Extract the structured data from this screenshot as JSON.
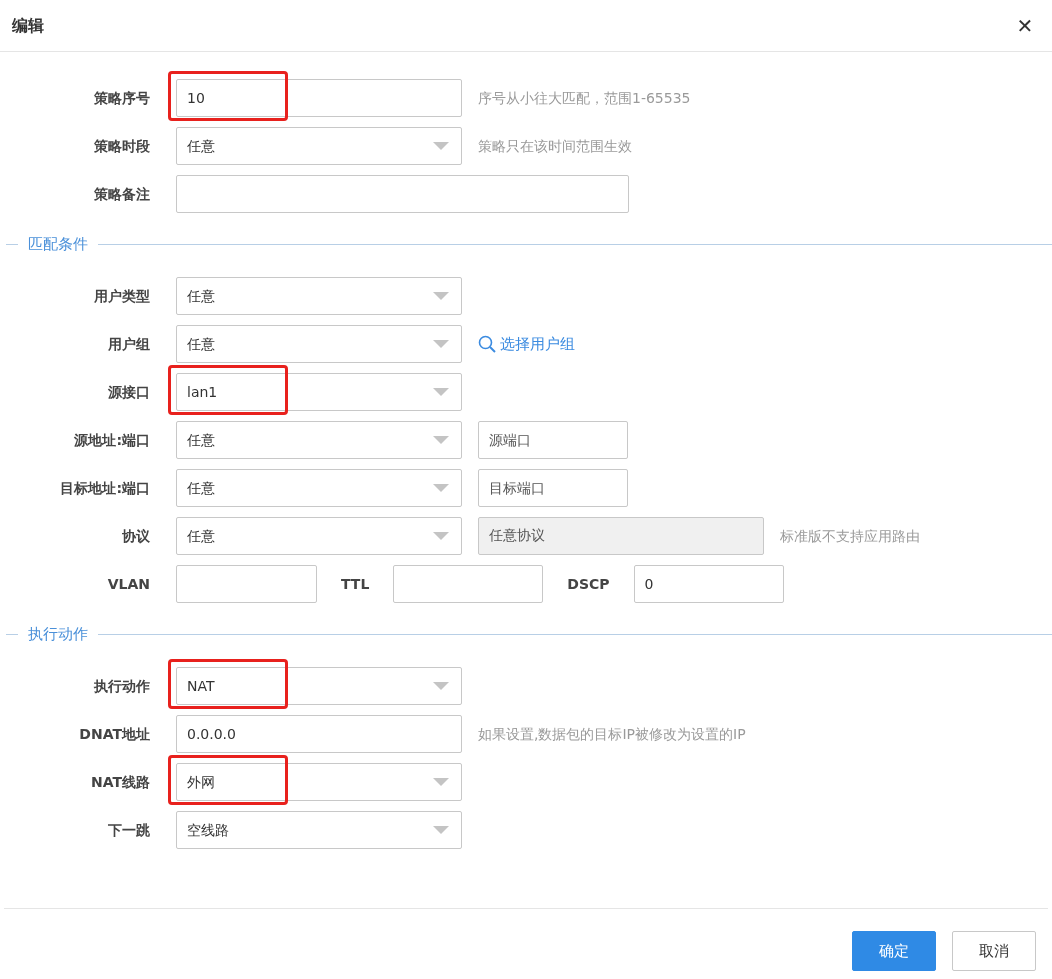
{
  "dialog": {
    "title": "编辑",
    "close": "✕"
  },
  "sections": [
    {
      "rows": [
        {
          "label": "策略序号",
          "controls": [
            {
              "kind": "input",
              "value": "10",
              "highlighted": true
            },
            {
              "kind": "hint",
              "text": "序号从小往大匹配，范围1-65535"
            }
          ]
        },
        {
          "label": "策略时段",
          "controls": [
            {
              "kind": "select",
              "value": "任意",
              "highlighted": false
            },
            {
              "kind": "hint",
              "text": "策略只在该时间范围生效"
            }
          ]
        },
        {
          "label": "策略备注",
          "controls": [
            {
              "kind": "wide-input",
              "highlighted": false
            }
          ]
        }
      ]
    },
    {
      "title": "匹配条件",
      "rows": [
        {
          "label": "用户类型",
          "controls": [
            {
              "kind": "select",
              "value": "任意",
              "highlighted": false
            }
          ]
        },
        {
          "label": "用户组",
          "controls": [
            {
              "kind": "select",
              "value": "任意",
              "highlighted": false
            },
            {
              "kind": "link",
              "text": "选择用户组"
            }
          ]
        },
        {
          "label": "源接口",
          "controls": [
            {
              "kind": "select",
              "value": "lan1",
              "highlighted": true
            }
          ]
        },
        {
          "label": "源地址:端口",
          "controls": [
            {
              "kind": "select",
              "value": "任意",
              "highlighted": false
            },
            {
              "kind": "short-input",
              "placeholder": "源端口",
              "highlighted": false
            }
          ]
        },
        {
          "label": "目标地址:端口",
          "controls": [
            {
              "kind": "select",
              "value": "任意",
              "highlighted": false
            },
            {
              "kind": "short-input",
              "placeholder": "目标端口",
              "highlighted": false
            }
          ]
        },
        {
          "label": "协议",
          "controls": [
            {
              "kind": "select",
              "value": "任意",
              "highlighted": false
            },
            {
              "kind": "input",
              "value": "任意协议",
              "disabled": true,
              "highlighted": false
            },
            {
              "kind": "hint",
              "text": "标准版不支持应用路由"
            }
          ]
        },
        {
          "label": "VLAN",
          "controls": [
            {
              "kind": "tiny-input",
              "highlighted": false
            },
            {
              "kind": "label",
              "text": "TTL"
            },
            {
              "kind": "short-input",
              "highlighted": false
            },
            {
              "kind": "label",
              "text": "DSCP"
            },
            {
              "kind": "short-input",
              "value": "0",
              "highlighted": false
            }
          ]
        }
      ]
    },
    {
      "title": "执行动作",
      "rows": [
        {
          "label": "执行动作",
          "controls": [
            {
              "kind": "select",
              "value": "NAT",
              "highlighted": true
            }
          ]
        },
        {
          "label": "DNAT地址",
          "controls": [
            {
              "kind": "input",
              "value": "0.0.0.0",
              "highlighted": false
            },
            {
              "kind": "hint",
              "text": "如果设置,数据包的目标IP被修改为设置的IP"
            }
          ]
        },
        {
          "label": "NAT线路",
          "controls": [
            {
              "kind": "select",
              "value": "外网",
              "highlighted": true
            }
          ]
        },
        {
          "label": "下一跳",
          "controls": [
            {
              "kind": "select",
              "value": "空线路",
              "highlighted": false
            }
          ]
        }
      ]
    }
  ],
  "buttons": [
    {
      "kind": "primary",
      "label": "确定"
    },
    {
      "kind": "secondary",
      "label": "取消"
    }
  ]
}
